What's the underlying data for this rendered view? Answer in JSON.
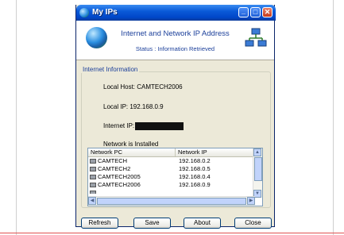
{
  "window": {
    "title": "My IPs",
    "controls": [
      "minimize-icon",
      "maximize-icon",
      "close-icon"
    ]
  },
  "header": {
    "title": "Internet and Network IP Address",
    "status": "Status : Information Retrieved"
  },
  "internet_info": {
    "group_label": "Internet Information",
    "local_host": "Local Host: CAMTECH2006",
    "local_ip": "Local IP: 192.168.0.9",
    "internet_ip_label": "Internet IP:",
    "network_status": "Network is Installed"
  },
  "network_list": {
    "columns": [
      "Network PC",
      "Network IP"
    ],
    "rows": [
      {
        "pc": "CAMTECH",
        "ip": "192.168.0.2"
      },
      {
        "pc": "CAMTECH2",
        "ip": "192.168.0.5"
      },
      {
        "pc": "CAMTECH2005",
        "ip": "192.168.0.4"
      },
      {
        "pc": "CAMTECH2006",
        "ip": "192.168.0.9"
      }
    ]
  },
  "buttons": {
    "refresh": "Refresh",
    "save": "Save",
    "about": "About",
    "close": "Close"
  },
  "colors": {
    "titlebar": "#0a5ad8",
    "header_text": "#1b3f9a",
    "window_bg": "#ece9d8",
    "page_bottom_line": "#e05050"
  }
}
